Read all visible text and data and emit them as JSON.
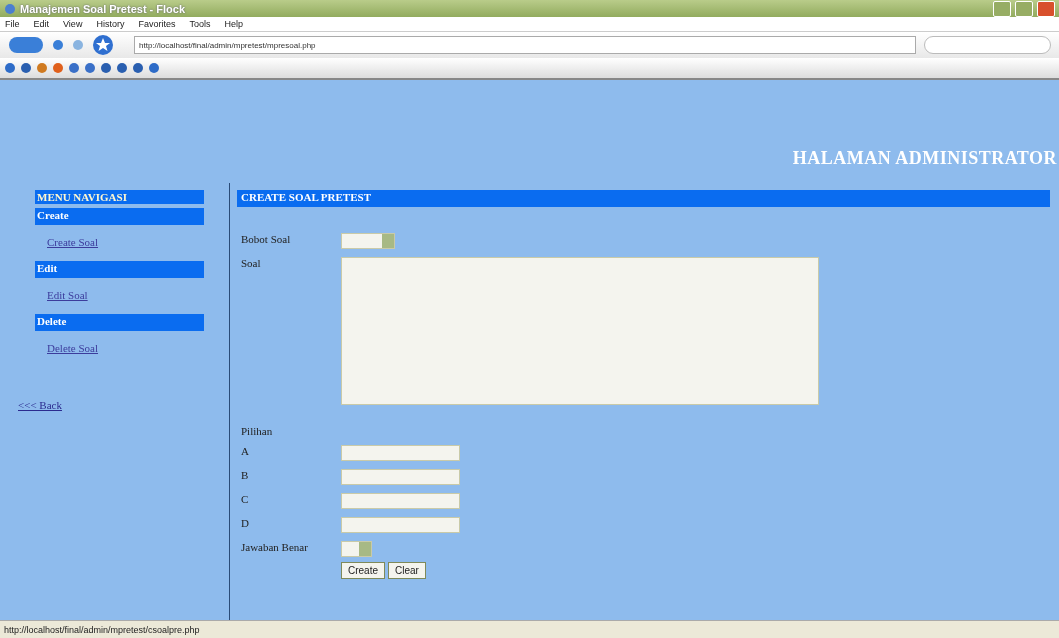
{
  "window": {
    "title": "Manajemen Soal Pretest - Flock"
  },
  "menu": [
    "File",
    "Edit",
    "View",
    "History",
    "Favorites",
    "Tools",
    "Help"
  ],
  "address": {
    "url": "http://localhost/final/admin/mpretest/mpresoal.php"
  },
  "header": {
    "title": "HALAMAN ADMINISTRATOR"
  },
  "nav": {
    "title": "MENU NAVIGASI",
    "sections": [
      {
        "title": "Create",
        "links": [
          "Create Soal"
        ]
      },
      {
        "title": "Edit",
        "links": [
          "Edit Soal"
        ]
      },
      {
        "title": "Delete",
        "links": [
          "Delete Soal"
        ]
      }
    ],
    "back": "<<< Back"
  },
  "form": {
    "title": "CREATE SOAL PRETEST",
    "fields": [
      {
        "kind": "select",
        "label": "Bobot Soal"
      },
      {
        "kind": "textarea",
        "label": "Soal"
      },
      {
        "kind": "heading",
        "label": "Pilihan"
      },
      {
        "kind": "text",
        "label": "A"
      },
      {
        "kind": "text",
        "label": "B"
      },
      {
        "kind": "text",
        "label": "C"
      },
      {
        "kind": "text",
        "label": "D"
      },
      {
        "kind": "minselect",
        "label": "Jawaban Benar"
      }
    ],
    "buttons": [
      "Create",
      "Clear"
    ]
  },
  "status_bar": {
    "text": "http://localhost/final/admin/mpretest/csoalpre.php"
  }
}
